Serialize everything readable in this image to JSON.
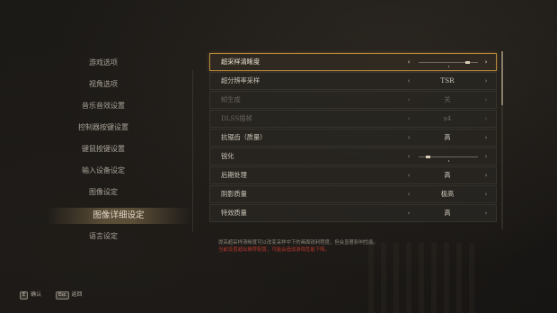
{
  "sidebar": {
    "items": [
      {
        "label": "游戏选项",
        "active": false
      },
      {
        "label": "视角选项",
        "active": false
      },
      {
        "label": "音乐音效设置",
        "active": false
      },
      {
        "label": "控制器按键设置",
        "active": false
      },
      {
        "label": "键鼠按键设置",
        "active": false
      },
      {
        "label": "输入设备设定",
        "active": false
      },
      {
        "label": "图像设定",
        "active": false
      },
      {
        "label": "图像详细设定",
        "active": true
      },
      {
        "label": "语言设定",
        "active": false
      }
    ]
  },
  "settings": {
    "rows": [
      {
        "label": "超采样清晰度",
        "type": "slider",
        "level": 0.8,
        "selected": true,
        "disabled": false
      },
      {
        "label": "超分辨率采样",
        "value": "TSR",
        "selected": false,
        "disabled": false
      },
      {
        "label": "帧生成",
        "value": "关",
        "selected": false,
        "disabled": true
      },
      {
        "label": "DLSS插帧",
        "value": "x4",
        "selected": false,
        "disabled": true
      },
      {
        "label": "抗锯齿（质量）",
        "value": "高",
        "selected": false,
        "disabled": false
      },
      {
        "label": "锐化",
        "type": "slider",
        "level": 0.15,
        "selected": false,
        "disabled": false
      },
      {
        "label": "后期处理",
        "value": "高",
        "selected": false,
        "disabled": false
      },
      {
        "label": "阴影质量",
        "value": "极高",
        "selected": false,
        "disabled": false
      },
      {
        "label": "特效质量",
        "value": "高",
        "selected": false,
        "disabled": false
      }
    ],
    "arrow_left": "‹",
    "arrow_right": "›"
  },
  "description": {
    "line1": "提高超采样清晰度可以改变采样中下的画面锐利程度，但会显著影响性能。",
    "line2": "当前设置超出推荐配置，可能会造成游戏性能下降。"
  },
  "footer": {
    "confirm": {
      "key": "E",
      "label": "确认"
    },
    "back": {
      "key": "Esc",
      "label": "返回"
    }
  },
  "colors": {
    "accent": "#b98a3a",
    "warning": "#b4372c",
    "background": "#191715"
  }
}
